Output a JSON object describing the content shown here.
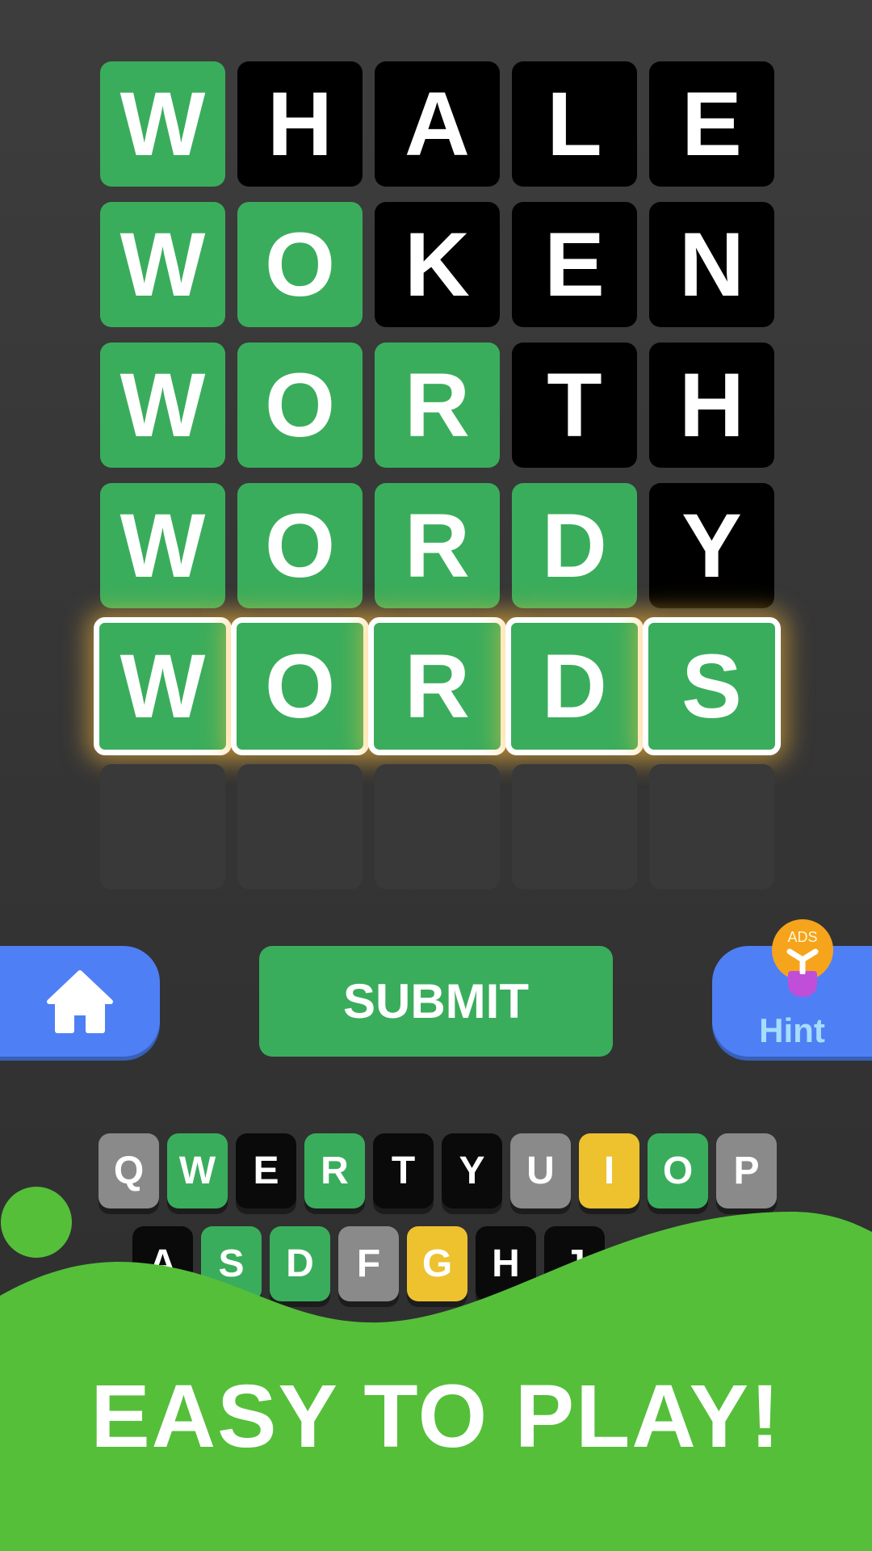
{
  "board": {
    "rows": [
      {
        "letters": [
          "W",
          "H",
          "A",
          "L",
          "E"
        ],
        "states": [
          "g",
          "b",
          "b",
          "b",
          "b"
        ]
      },
      {
        "letters": [
          "W",
          "O",
          "K",
          "E",
          "N"
        ],
        "states": [
          "g",
          "g",
          "b",
          "b",
          "b"
        ]
      },
      {
        "letters": [
          "W",
          "O",
          "R",
          "T",
          "H"
        ],
        "states": [
          "g",
          "g",
          "g",
          "b",
          "b"
        ]
      },
      {
        "letters": [
          "W",
          "O",
          "R",
          "D",
          "Y"
        ],
        "states": [
          "g",
          "g",
          "g",
          "g",
          "b"
        ]
      },
      {
        "letters": [
          "W",
          "O",
          "R",
          "D",
          "S"
        ],
        "states": [
          "g",
          "g",
          "g",
          "g",
          "g"
        ]
      },
      {
        "letters": [
          "",
          "",
          "",
          "",
          ""
        ],
        "states": [
          "e",
          "e",
          "e",
          "e",
          "e"
        ]
      }
    ]
  },
  "buttons": {
    "home_icon": "home-icon",
    "submit": "SUBMIT",
    "hint": "Hint",
    "hint_badge": "ADS",
    "hint_icon": "lightbulb-icon"
  },
  "keyboard": {
    "rows": [
      {
        "keys": [
          "Q",
          "W",
          "E",
          "R",
          "T",
          "Y",
          "U",
          "I",
          "O",
          "P"
        ],
        "states": [
          "r",
          "g",
          "b",
          "g",
          "b",
          "b",
          "r",
          "y",
          "g",
          "r"
        ]
      },
      {
        "keys": [
          "A",
          "S",
          "D",
          "F",
          "G",
          "H",
          "J"
        ],
        "states": [
          "b",
          "g",
          "g",
          "r",
          "y",
          "b",
          "b"
        ]
      }
    ]
  },
  "banner": {
    "title": "EASY TO PLAY!"
  },
  "colors": {
    "correct": "#3aad5c",
    "absent": "#000000",
    "present": "#eec12f",
    "unused": "#8a8a8a",
    "accent_blue": "#4f7ff5",
    "banner_green": "#55bf3a"
  }
}
